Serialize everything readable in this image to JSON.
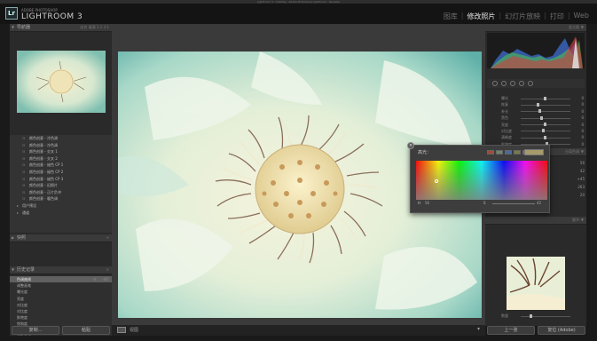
{
  "window": {
    "title": "Lightroom 3 - Catalog - Adobe Photoshop Lightroom - Develop"
  },
  "brand": {
    "small": "ADOBE PHOTOSHOP",
    "big": "LIGHTROOM 3",
    "logo": "Lr"
  },
  "modules": [
    {
      "label": "图库",
      "active": false
    },
    {
      "label": "修改照片",
      "active": true
    },
    {
      "label": "幻灯片放映",
      "active": false
    },
    {
      "label": "打印",
      "active": false
    },
    {
      "label": "Web",
      "active": false
    }
  ],
  "left_panel": {
    "navigator_title": "导航器",
    "navigator_zoom": "适合  填满  1:1  3:1",
    "presets": [
      "颜色创意 - 冷色调",
      "颜色创意 - 冷色调",
      "颜色创意 - 交叉 1",
      "颜色创意 - 交叉 2",
      "颜色创意 - 褪色 CP 1",
      "颜色创意 - 褪色 CP 2",
      "颜色创意 - 褪色 CP 3",
      "颜色创意 - 旧照片",
      "颜色创意 - 正片负冲",
      "颜色创意 - 暖色调"
    ],
    "preset_folders": [
      "用户预设",
      "通道"
    ],
    "snapshots_title": "快照",
    "history_title": "历史记录",
    "history_items": [
      {
        "label": "色调曲线",
        "v1": "-4",
        "v2": "-40",
        "selected": true
      },
      {
        "label": "调整画笔",
        "v1": "",
        "v2": "",
        "selected": false
      },
      {
        "label": "曝光度",
        "v1": "",
        "v2": "",
        "selected": false
      },
      {
        "label": "亮度",
        "v1": "",
        "v2": "",
        "selected": false
      },
      {
        "label": "对比度",
        "v1": "",
        "v2": "",
        "selected": false
      },
      {
        "label": "对比度",
        "v1": "",
        "v2": "",
        "selected": false
      },
      {
        "label": "鲜艳度",
        "v1": "",
        "v2": "",
        "selected": false
      },
      {
        "label": "饱和度",
        "v1": "",
        "v2": "",
        "selected": false
      },
      {
        "label": "分离色调平衡",
        "v1": "",
        "v2": "",
        "selected": false
      },
      {
        "label": "调整色相",
        "v1": "",
        "v2": "",
        "selected": false
      }
    ],
    "copy_button": "复制...",
    "paste_button": "粘贴"
  },
  "right_panel": {
    "histogram_title": "直方图",
    "basic_sliders": [
      {
        "label": "曝光",
        "value": "0"
      },
      {
        "label": "恢复",
        "value": "0"
      },
      {
        "label": "补光",
        "value": "0"
      },
      {
        "label": "黑色",
        "value": "0"
      },
      {
        "label": "亮度",
        "value": "0"
      },
      {
        "label": "对比度",
        "value": "0"
      },
      {
        "label": "清晰度",
        "value": "0"
      },
      {
        "label": "鲜艳度",
        "value": "0"
      }
    ],
    "split_tone_title": "分离色调",
    "split_values": [
      "56",
      "42",
      "+45",
      "263",
      "20"
    ],
    "detail_title": "细节",
    "detail_sliders": [
      {
        "label": "数量",
        "value": ""
      },
      {
        "label": "半径",
        "value": ""
      },
      {
        "label": "细节",
        "value": ""
      }
    ],
    "prev_button": "上一张",
    "reset_button": "复位 (Adobe)"
  },
  "color_popup": {
    "label": "高光：",
    "h_label": "H",
    "h_value": "56",
    "s_label": "S",
    "s_value": "42",
    "current_color": "#a79a6b",
    "swatches": [
      "#a04a3a",
      "#6a8a6a",
      "#4a6aa0",
      "#7a7a4a",
      "#8a6a8a"
    ]
  },
  "toolbar": {
    "view_label": "视图"
  },
  "colors": {
    "accent": "#d0d0d0",
    "panel_bg": "#2a2a2a"
  }
}
